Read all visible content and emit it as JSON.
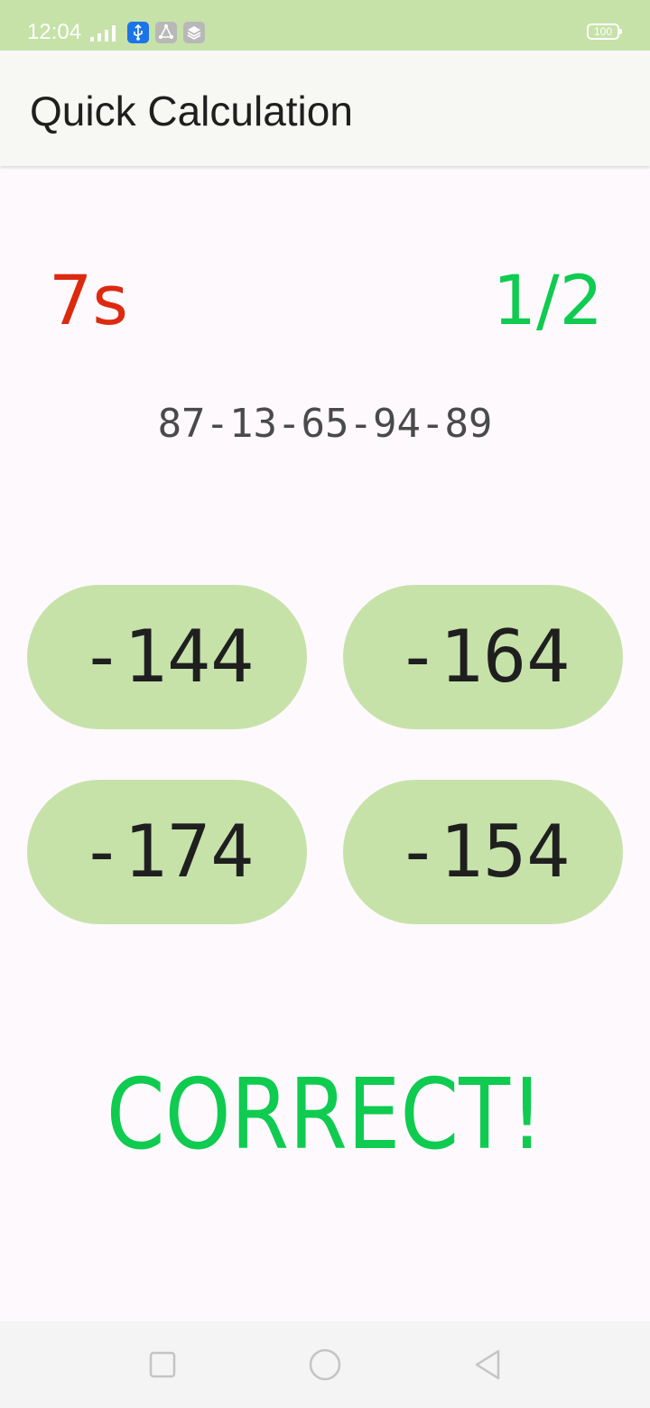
{
  "status_bar": {
    "time": "12:04",
    "battery": "100",
    "icons": [
      "signal-icon",
      "usb-icon",
      "share-icon",
      "layers-icon",
      "battery-icon"
    ]
  },
  "app_bar": {
    "title": "Quick Calculation"
  },
  "game": {
    "timer": "7s",
    "progress": "1/2",
    "question": "87-13-65-94-89",
    "answers": [
      "-144",
      "-164",
      "-174",
      "-154"
    ],
    "result": "CORRECT!"
  },
  "nav_bar": {
    "icons": [
      "recents-icon",
      "home-icon",
      "back-icon"
    ]
  },
  "colors": {
    "accent": "#c6e2a9",
    "timer": "#dd2a0f",
    "success": "#0fcb50"
  }
}
